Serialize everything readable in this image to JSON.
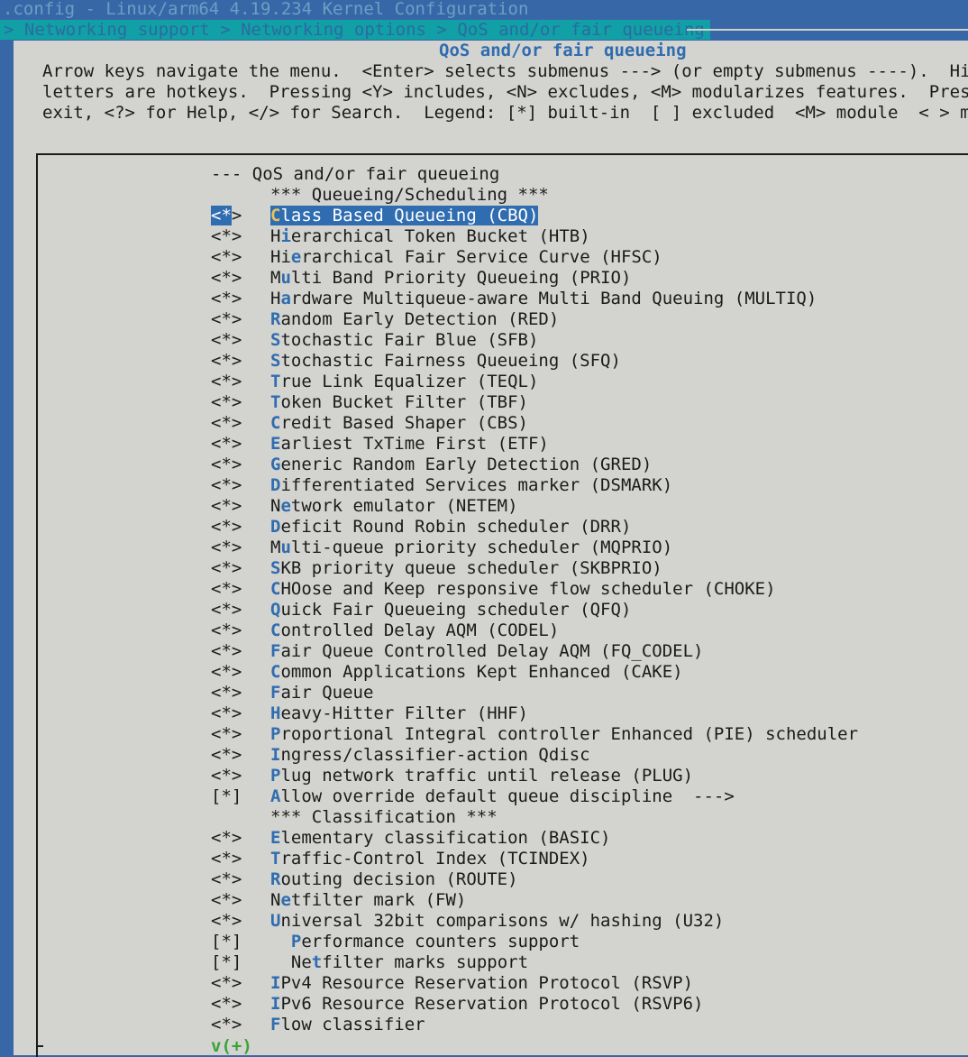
{
  "window_title": ".config - Linux/arm64 4.19.234 Kernel Configuration",
  "breadcrumb": "> Networking support > Networking options > QoS and/or fair queueing",
  "dialog": {
    "title": "QoS and/or fair queueing",
    "help_lines": [
      "Arrow keys navigate the menu.  <Enter> selects submenus ---> (or empty submenus ----).  Highli",
      "letters are hotkeys.  Pressing <Y> includes, <N> excludes, <M> modularizes features.  Press <E",
      "exit, <?> for Help, </> for Search.  Legend: [*] built-in  [ ] excluded  <M> module  < > modul"
    ]
  },
  "menu": {
    "items": [
      {
        "mark": "---",
        "indent": "",
        "label": "QoS and/or fair queueing",
        "hot": 0,
        "raw": true
      },
      {
        "mark": "",
        "indent": "",
        "label": "*** Queueing/Scheduling ***",
        "hot": -1
      },
      {
        "mark": "<*>",
        "indent": "",
        "label": "Class Based Queueing (CBQ)",
        "hot": 0,
        "selected": true
      },
      {
        "mark": "<*>",
        "indent": "",
        "label": "Hierarchical Token Bucket (HTB)",
        "hot": 1
      },
      {
        "mark": "<*>",
        "indent": "",
        "label": "Hierarchical Fair Service Curve (HFSC)",
        "hot": 2
      },
      {
        "mark": "<*>",
        "indent": "",
        "label": "Multi Band Priority Queueing (PRIO)",
        "hot": 1
      },
      {
        "mark": "<*>",
        "indent": "",
        "label": "Hardware Multiqueue-aware Multi Band Queuing (MULTIQ)",
        "hot": 1
      },
      {
        "mark": "<*>",
        "indent": "",
        "label": "Random Early Detection (RED)",
        "hot": 0
      },
      {
        "mark": "<*>",
        "indent": "",
        "label": "Stochastic Fair Blue (SFB)",
        "hot": 0
      },
      {
        "mark": "<*>",
        "indent": "",
        "label": "Stochastic Fairness Queueing (SFQ)",
        "hot": 0
      },
      {
        "mark": "<*>",
        "indent": "",
        "label": "True Link Equalizer (TEQL)",
        "hot": 0
      },
      {
        "mark": "<*>",
        "indent": "",
        "label": "Token Bucket Filter (TBF)",
        "hot": 0
      },
      {
        "mark": "<*>",
        "indent": "",
        "label": "Credit Based Shaper (CBS)",
        "hot": 0
      },
      {
        "mark": "<*>",
        "indent": "",
        "label": "Earliest TxTime First (ETF)",
        "hot": 0
      },
      {
        "mark": "<*>",
        "indent": "",
        "label": "Generic Random Early Detection (GRED)",
        "hot": 0
      },
      {
        "mark": "<*>",
        "indent": "",
        "label": "Differentiated Services marker (DSMARK)",
        "hot": 0
      },
      {
        "mark": "<*>",
        "indent": "",
        "label": "Network emulator (NETEM)",
        "hot": 1
      },
      {
        "mark": "<*>",
        "indent": "",
        "label": "Deficit Round Robin scheduler (DRR)",
        "hot": 0
      },
      {
        "mark": "<*>",
        "indent": "",
        "label": "Multi-queue priority scheduler (MQPRIO)",
        "hot": 1
      },
      {
        "mark": "<*>",
        "indent": "",
        "label": "SKB priority queue scheduler (SKBPRIO)",
        "hot": 0
      },
      {
        "mark": "<*>",
        "indent": "",
        "label": "CHOose and Keep responsive flow scheduler (CHOKE)",
        "hot": 0
      },
      {
        "mark": "<*>",
        "indent": "",
        "label": "Quick Fair Queueing scheduler (QFQ)",
        "hot": 0
      },
      {
        "mark": "<*>",
        "indent": "",
        "label": "Controlled Delay AQM (CODEL)",
        "hot": 0
      },
      {
        "mark": "<*>",
        "indent": "",
        "label": "Fair Queue Controlled Delay AQM (FQ_CODEL)",
        "hot": 0
      },
      {
        "mark": "<*>",
        "indent": "",
        "label": "Common Applications Kept Enhanced (CAKE)",
        "hot": 0
      },
      {
        "mark": "<*>",
        "indent": "",
        "label": "Fair Queue",
        "hot": 0
      },
      {
        "mark": "<*>",
        "indent": "",
        "label": "Heavy-Hitter Filter (HHF)",
        "hot": 0
      },
      {
        "mark": "<*>",
        "indent": "",
        "label": "Proportional Integral controller Enhanced (PIE) scheduler",
        "hot": 0
      },
      {
        "mark": "<*>",
        "indent": "",
        "label": "Ingress/classifier-action Qdisc",
        "hot": 0
      },
      {
        "mark": "<*>",
        "indent": "",
        "label": "Plug network traffic until release (PLUG)",
        "hot": 0
      },
      {
        "mark": "[*]",
        "indent": "",
        "label": "Allow override default queue discipline  --->",
        "hot": 0
      },
      {
        "mark": "",
        "indent": "",
        "label": "*** Classification ***",
        "hot": -1
      },
      {
        "mark": "<*>",
        "indent": "",
        "label": "Elementary classification (BASIC)",
        "hot": 0
      },
      {
        "mark": "<*>",
        "indent": "",
        "label": "Traffic-Control Index (TCINDEX)",
        "hot": 0
      },
      {
        "mark": "<*>",
        "indent": "",
        "label": "Routing decision (ROUTE)",
        "hot": 0
      },
      {
        "mark": "<*>",
        "indent": "",
        "label": "Netfilter mark (FW)",
        "hot": 1
      },
      {
        "mark": "<*>",
        "indent": "",
        "label": "Universal 32bit comparisons w/ hashing (U32)",
        "hot": 0
      },
      {
        "mark": "[*]",
        "indent": "  ",
        "label": "Performance counters support",
        "hot": 0
      },
      {
        "mark": "[*]",
        "indent": "  ",
        "label": "Netfilter marks support",
        "hot": 2
      },
      {
        "mark": "<*>",
        "indent": "",
        "label": "IPv4 Resource Reservation Protocol (RSVP)",
        "hot": 0
      },
      {
        "mark": "<*>",
        "indent": "",
        "label": "IPv6 Resource Reservation Protocol (RSVP6)",
        "hot": 0
      },
      {
        "mark": "<*>",
        "indent": "",
        "label": "Flow classifier",
        "hot": 0
      }
    ],
    "more_indicator": "v(+)"
  }
}
